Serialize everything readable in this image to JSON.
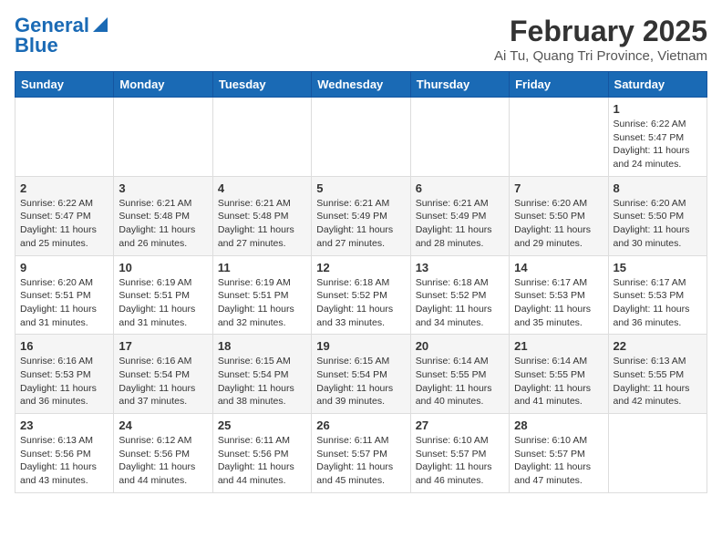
{
  "header": {
    "logo_line1": "General",
    "logo_line2": "Blue",
    "month": "February 2025",
    "location": "Ai Tu, Quang Tri Province, Vietnam"
  },
  "days_of_week": [
    "Sunday",
    "Monday",
    "Tuesday",
    "Wednesday",
    "Thursday",
    "Friday",
    "Saturday"
  ],
  "weeks": [
    [
      {
        "day": "",
        "info": ""
      },
      {
        "day": "",
        "info": ""
      },
      {
        "day": "",
        "info": ""
      },
      {
        "day": "",
        "info": ""
      },
      {
        "day": "",
        "info": ""
      },
      {
        "day": "",
        "info": ""
      },
      {
        "day": "1",
        "info": "Sunrise: 6:22 AM\nSunset: 5:47 PM\nDaylight: 11 hours\nand 24 minutes."
      }
    ],
    [
      {
        "day": "2",
        "info": "Sunrise: 6:22 AM\nSunset: 5:47 PM\nDaylight: 11 hours\nand 25 minutes."
      },
      {
        "day": "3",
        "info": "Sunrise: 6:21 AM\nSunset: 5:48 PM\nDaylight: 11 hours\nand 26 minutes."
      },
      {
        "day": "4",
        "info": "Sunrise: 6:21 AM\nSunset: 5:48 PM\nDaylight: 11 hours\nand 27 minutes."
      },
      {
        "day": "5",
        "info": "Sunrise: 6:21 AM\nSunset: 5:49 PM\nDaylight: 11 hours\nand 27 minutes."
      },
      {
        "day": "6",
        "info": "Sunrise: 6:21 AM\nSunset: 5:49 PM\nDaylight: 11 hours\nand 28 minutes."
      },
      {
        "day": "7",
        "info": "Sunrise: 6:20 AM\nSunset: 5:50 PM\nDaylight: 11 hours\nand 29 minutes."
      },
      {
        "day": "8",
        "info": "Sunrise: 6:20 AM\nSunset: 5:50 PM\nDaylight: 11 hours\nand 30 minutes."
      }
    ],
    [
      {
        "day": "9",
        "info": "Sunrise: 6:20 AM\nSunset: 5:51 PM\nDaylight: 11 hours\nand 31 minutes."
      },
      {
        "day": "10",
        "info": "Sunrise: 6:19 AM\nSunset: 5:51 PM\nDaylight: 11 hours\nand 31 minutes."
      },
      {
        "day": "11",
        "info": "Sunrise: 6:19 AM\nSunset: 5:51 PM\nDaylight: 11 hours\nand 32 minutes."
      },
      {
        "day": "12",
        "info": "Sunrise: 6:18 AM\nSunset: 5:52 PM\nDaylight: 11 hours\nand 33 minutes."
      },
      {
        "day": "13",
        "info": "Sunrise: 6:18 AM\nSunset: 5:52 PM\nDaylight: 11 hours\nand 34 minutes."
      },
      {
        "day": "14",
        "info": "Sunrise: 6:17 AM\nSunset: 5:53 PM\nDaylight: 11 hours\nand 35 minutes."
      },
      {
        "day": "15",
        "info": "Sunrise: 6:17 AM\nSunset: 5:53 PM\nDaylight: 11 hours\nand 36 minutes."
      }
    ],
    [
      {
        "day": "16",
        "info": "Sunrise: 6:16 AM\nSunset: 5:53 PM\nDaylight: 11 hours\nand 36 minutes."
      },
      {
        "day": "17",
        "info": "Sunrise: 6:16 AM\nSunset: 5:54 PM\nDaylight: 11 hours\nand 37 minutes."
      },
      {
        "day": "18",
        "info": "Sunrise: 6:15 AM\nSunset: 5:54 PM\nDaylight: 11 hours\nand 38 minutes."
      },
      {
        "day": "19",
        "info": "Sunrise: 6:15 AM\nSunset: 5:54 PM\nDaylight: 11 hours\nand 39 minutes."
      },
      {
        "day": "20",
        "info": "Sunrise: 6:14 AM\nSunset: 5:55 PM\nDaylight: 11 hours\nand 40 minutes."
      },
      {
        "day": "21",
        "info": "Sunrise: 6:14 AM\nSunset: 5:55 PM\nDaylight: 11 hours\nand 41 minutes."
      },
      {
        "day": "22",
        "info": "Sunrise: 6:13 AM\nSunset: 5:55 PM\nDaylight: 11 hours\nand 42 minutes."
      }
    ],
    [
      {
        "day": "23",
        "info": "Sunrise: 6:13 AM\nSunset: 5:56 PM\nDaylight: 11 hours\nand 43 minutes."
      },
      {
        "day": "24",
        "info": "Sunrise: 6:12 AM\nSunset: 5:56 PM\nDaylight: 11 hours\nand 44 minutes."
      },
      {
        "day": "25",
        "info": "Sunrise: 6:11 AM\nSunset: 5:56 PM\nDaylight: 11 hours\nand 44 minutes."
      },
      {
        "day": "26",
        "info": "Sunrise: 6:11 AM\nSunset: 5:57 PM\nDaylight: 11 hours\nand 45 minutes."
      },
      {
        "day": "27",
        "info": "Sunrise: 6:10 AM\nSunset: 5:57 PM\nDaylight: 11 hours\nand 46 minutes."
      },
      {
        "day": "28",
        "info": "Sunrise: 6:10 AM\nSunset: 5:57 PM\nDaylight: 11 hours\nand 47 minutes."
      },
      {
        "day": "",
        "info": ""
      }
    ]
  ],
  "accent_color": "#1a6ab5"
}
